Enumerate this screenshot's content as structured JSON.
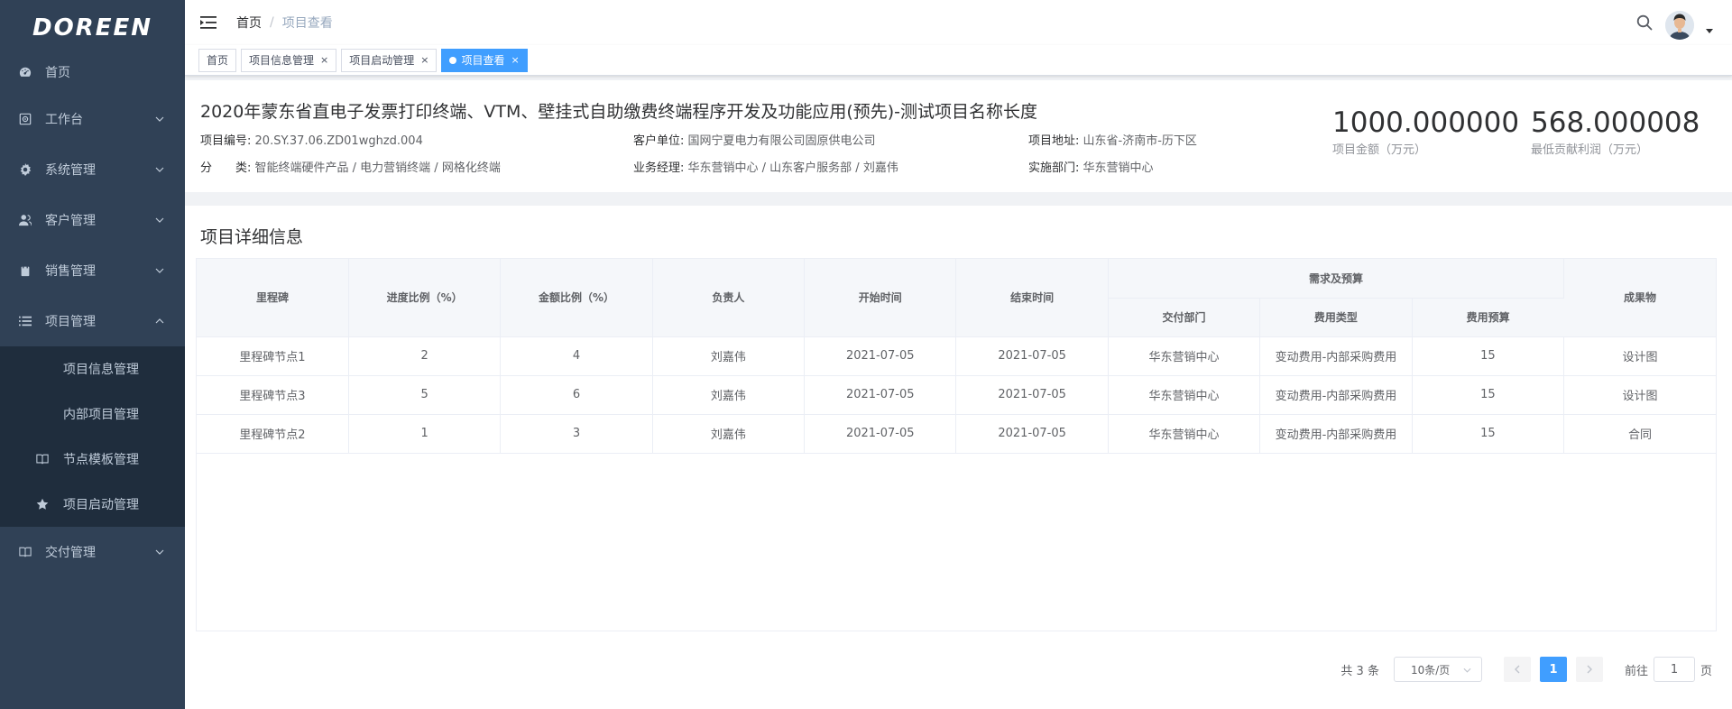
{
  "sidebar": {
    "logo": "DOREEN",
    "menu": [
      {
        "label": "首页",
        "icon": "dashboard-icon"
      },
      {
        "label": "工作台",
        "icon": "workbench-icon"
      },
      {
        "label": "系统管理",
        "icon": "gear-icon"
      },
      {
        "label": "客户管理",
        "icon": "user-icon"
      },
      {
        "label": "销售管理",
        "icon": "shopping-icon"
      },
      {
        "label": "项目管理",
        "icon": "list-icon"
      },
      {
        "label": "交付管理",
        "icon": "book-icon"
      }
    ],
    "submenu": [
      {
        "label": "项目信息管理"
      },
      {
        "label": "内部项目管理"
      },
      {
        "label": "节点模板管理",
        "icon": "book-icon"
      },
      {
        "label": "项目启动管理",
        "icon": "star-icon"
      }
    ]
  },
  "navbar": {
    "breadcrumb_home": "首页",
    "breadcrumb_sep": "/",
    "breadcrumb_current": "项目查看"
  },
  "tags": [
    {
      "label": "首页",
      "closable": false
    },
    {
      "label": "项目信息管理",
      "closable": true
    },
    {
      "label": "项目启动管理",
      "closable": true
    },
    {
      "label": "项目查看",
      "closable": true,
      "active": true
    }
  ],
  "tag_close": "×",
  "project": {
    "title": "2020年蒙东省直电子发票打印终端、VTM、壁挂式自助缴费终端程序开发及功能应用(预先)-测试项目名称长度",
    "code_label": "项目编号:",
    "code": "20.SY.37.06.ZD01wghzd.004",
    "customer_label": "客户单位:",
    "customer": "国网宁夏电力有限公司固原供电公司",
    "address_label": "项目地址:",
    "address": "山东省-济南市-历下区",
    "category_label": "分　　类:",
    "category": "智能终端硬件产品 / 电力营销终端 / 网格化终端",
    "manager_label": "业务经理:",
    "manager": "华东营销中心 / 山东客户服务部 / 刘嘉伟",
    "dept_label": "实施部门:",
    "dept": "华东营销中心",
    "amount": "1000.000000",
    "amount_caption": "项目金额（万元）",
    "profit": "568.000008",
    "profit_caption": "最低贡献利润（万元）"
  },
  "detail": {
    "title": "项目详细信息",
    "headers": {
      "milestone": "里程碑",
      "progress": "进度比例（%）",
      "amount_ratio": "金额比例（%）",
      "owner": "负责人",
      "start": "开始时间",
      "end": "结束时间",
      "budget_group": "需求及预算",
      "delivery_dept": "交付部门",
      "fee_type": "费用类型",
      "fee_budget": "费用预算",
      "deliverable": "成果物"
    },
    "rows": [
      {
        "milestone": "里程碑节点1",
        "progress": "2",
        "amount_ratio": "4",
        "owner": "刘嘉伟",
        "start": "2021-07-05",
        "end": "2021-07-05",
        "delivery_dept": "华东营销中心",
        "fee_type": "变动费用-内部采购费用",
        "fee_budget": "15",
        "deliverable": "设计图"
      },
      {
        "milestone": "里程碑节点3",
        "progress": "5",
        "amount_ratio": "6",
        "owner": "刘嘉伟",
        "start": "2021-07-05",
        "end": "2021-07-05",
        "delivery_dept": "华东营销中心",
        "fee_type": "变动费用-内部采购费用",
        "fee_budget": "15",
        "deliverable": "设计图"
      },
      {
        "milestone": "里程碑节点2",
        "progress": "1",
        "amount_ratio": "3",
        "owner": "刘嘉伟",
        "start": "2021-07-05",
        "end": "2021-07-05",
        "delivery_dept": "华东营销中心",
        "fee_type": "变动费用-内部采购费用",
        "fee_budget": "15",
        "deliverable": "合同"
      }
    ]
  },
  "pagination": {
    "total": "共 3 条",
    "page_size": "10条/页",
    "current_page": "1",
    "jump_prefix": "前往",
    "jump_value": "1",
    "jump_suffix": "页"
  },
  "colors": {
    "sidebar_bg": "#304156",
    "submenu_bg": "#1f2d3d",
    "primary": "#409eff"
  }
}
